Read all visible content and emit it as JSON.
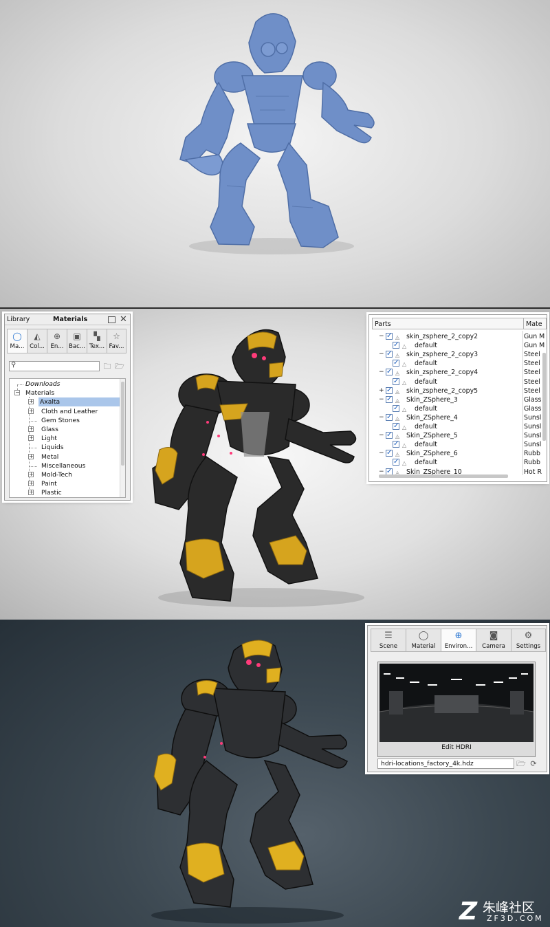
{
  "library": {
    "title": "Library",
    "header": "Materials",
    "tabs": [
      {
        "label": "Ma...",
        "icon": "material-icon"
      },
      {
        "label": "Col...",
        "icon": "color-icon"
      },
      {
        "label": "En...",
        "icon": "environment-icon"
      },
      {
        "label": "Bac...",
        "icon": "backplate-icon"
      },
      {
        "label": "Tex...",
        "icon": "texture-icon"
      },
      {
        "label": "Fav...",
        "icon": "favorite-icon"
      }
    ],
    "search": {
      "value": "",
      "placeholder": ""
    },
    "tree": [
      "Downloads",
      "Materials",
      "Axalta",
      "Cloth and Leather",
      "Gem Stones",
      "Glass",
      "Light",
      "Liquids",
      "Metal",
      "Miscellaneous",
      "Mold-Tech",
      "Paint",
      "Plastic"
    ],
    "selected": "Axalta"
  },
  "parts": {
    "col_parts": "Parts",
    "col_material": "Mate",
    "rows": [
      {
        "name": "skin_zsphere_2_copy2",
        "material": "Gun M"
      },
      {
        "name": "default",
        "material": "Gun M"
      },
      {
        "name": "skin_zsphere_2_copy3",
        "material": "Steel"
      },
      {
        "name": "default",
        "material": "Steel"
      },
      {
        "name": "skin_zsphere_2_copy4",
        "material": "Steel"
      },
      {
        "name": "default",
        "material": "Steel"
      },
      {
        "name": "skin_zsphere_2_copy5",
        "material": "Steel"
      },
      {
        "name": "Skin_ZSphere_3",
        "material": "Glass"
      },
      {
        "name": "default",
        "material": "Glass"
      },
      {
        "name": "Skin_ZSphere_4",
        "material": "Sunsl"
      },
      {
        "name": "default",
        "material": "Sunsl"
      },
      {
        "name": "Skin_ZSphere_5",
        "material": "Sunsl"
      },
      {
        "name": "default",
        "material": "Sunsl"
      },
      {
        "name": "Skin_ZSphere_6",
        "material": "Rubb"
      },
      {
        "name": "default",
        "material": "Rubb"
      },
      {
        "name": "Skin_ZSphere_10",
        "material": "Hot R"
      }
    ]
  },
  "environment": {
    "tabs": [
      {
        "label": "Scene"
      },
      {
        "label": "Material"
      },
      {
        "label": "Environ..."
      },
      {
        "label": "Camera"
      },
      {
        "label": "Settings"
      }
    ],
    "edit_label": "Edit HDRI",
    "file": "hdri-locations_factory_4k.hdz"
  },
  "watermark": {
    "logo": "Z",
    "brand": "朱峰社区",
    "domain": "ZF3D.COM"
  },
  "colors": {
    "clay": "#6f8fc8",
    "armor": "#2a2a2a",
    "gold": "#d6a41e",
    "glow": "#ff3b7a",
    "select": "#aac6ea",
    "accent": "#1f6fcf"
  }
}
